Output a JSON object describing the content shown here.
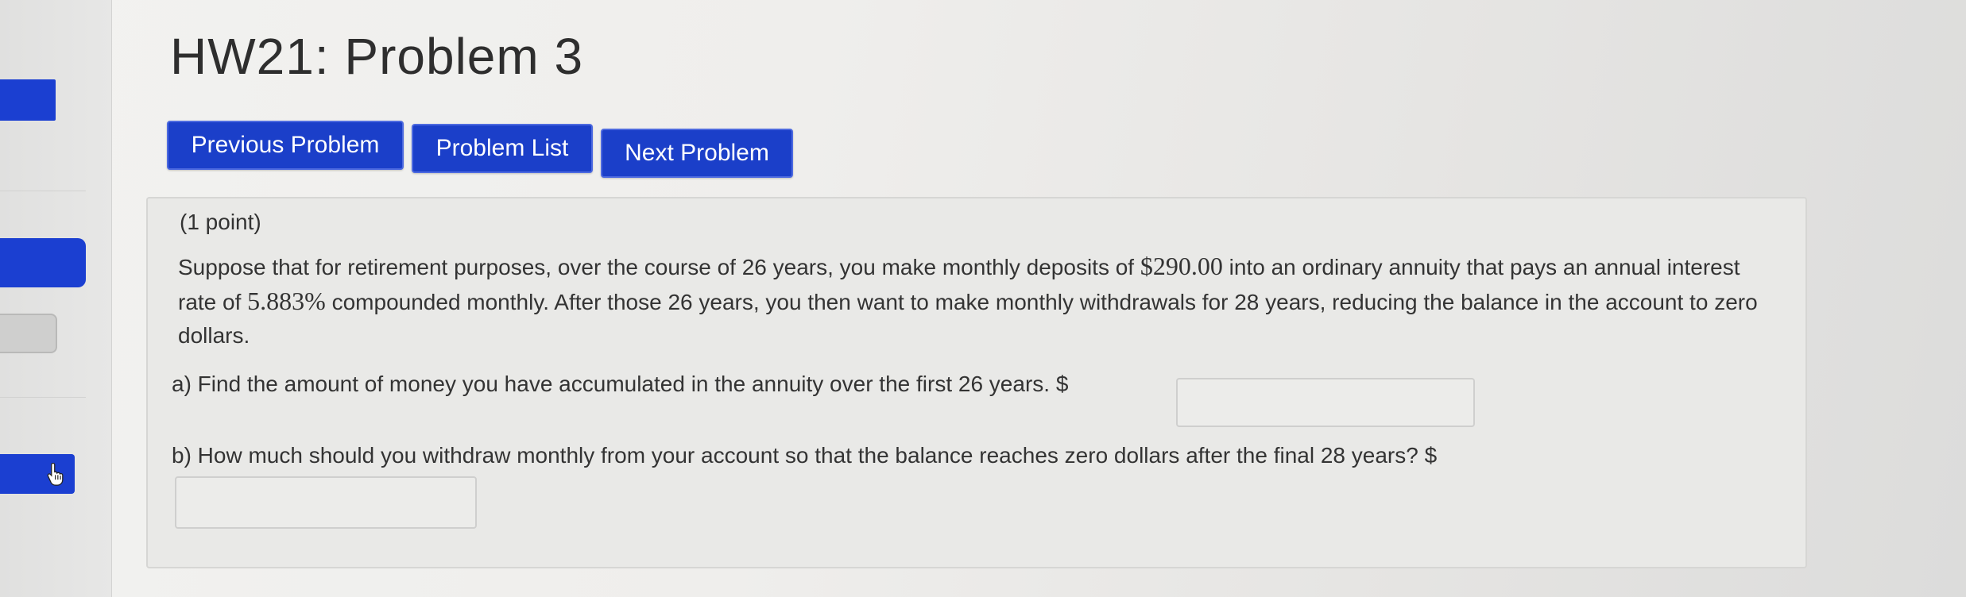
{
  "page": {
    "title": "HW21: Problem 3"
  },
  "nav": {
    "previous_label": "Previous Problem",
    "list_label": "Problem List",
    "next_label": "Next Problem"
  },
  "problem": {
    "points": "(1 point)",
    "statement": {
      "t1": "Suppose that for retirement purposes, over the course of 26 years, you make monthly deposits of ",
      "deposit": "$290.00",
      "t2": " into an ordinary annuity that pays an annual interest rate of ",
      "rate": "5.883%",
      "t3": " compounded monthly. After those 26 years, you then want to make monthly withdrawals for 28 years, reducing the balance in the account to zero dollars."
    },
    "part_a": {
      "text": "a) Find the amount of money you have accumulated in the annuity over the first 26 years. $",
      "value": ""
    },
    "part_b": {
      "text": "b) How much should you withdraw monthly from your account so that the balance reaches zero dollars after the final 28 years? $",
      "value": ""
    }
  },
  "sidebar": {
    "cursor_icon": "hand-pointer-icon"
  },
  "colors": {
    "button_blue": "#1b3fc9",
    "sidebar_blue": "#1b3fd1"
  }
}
